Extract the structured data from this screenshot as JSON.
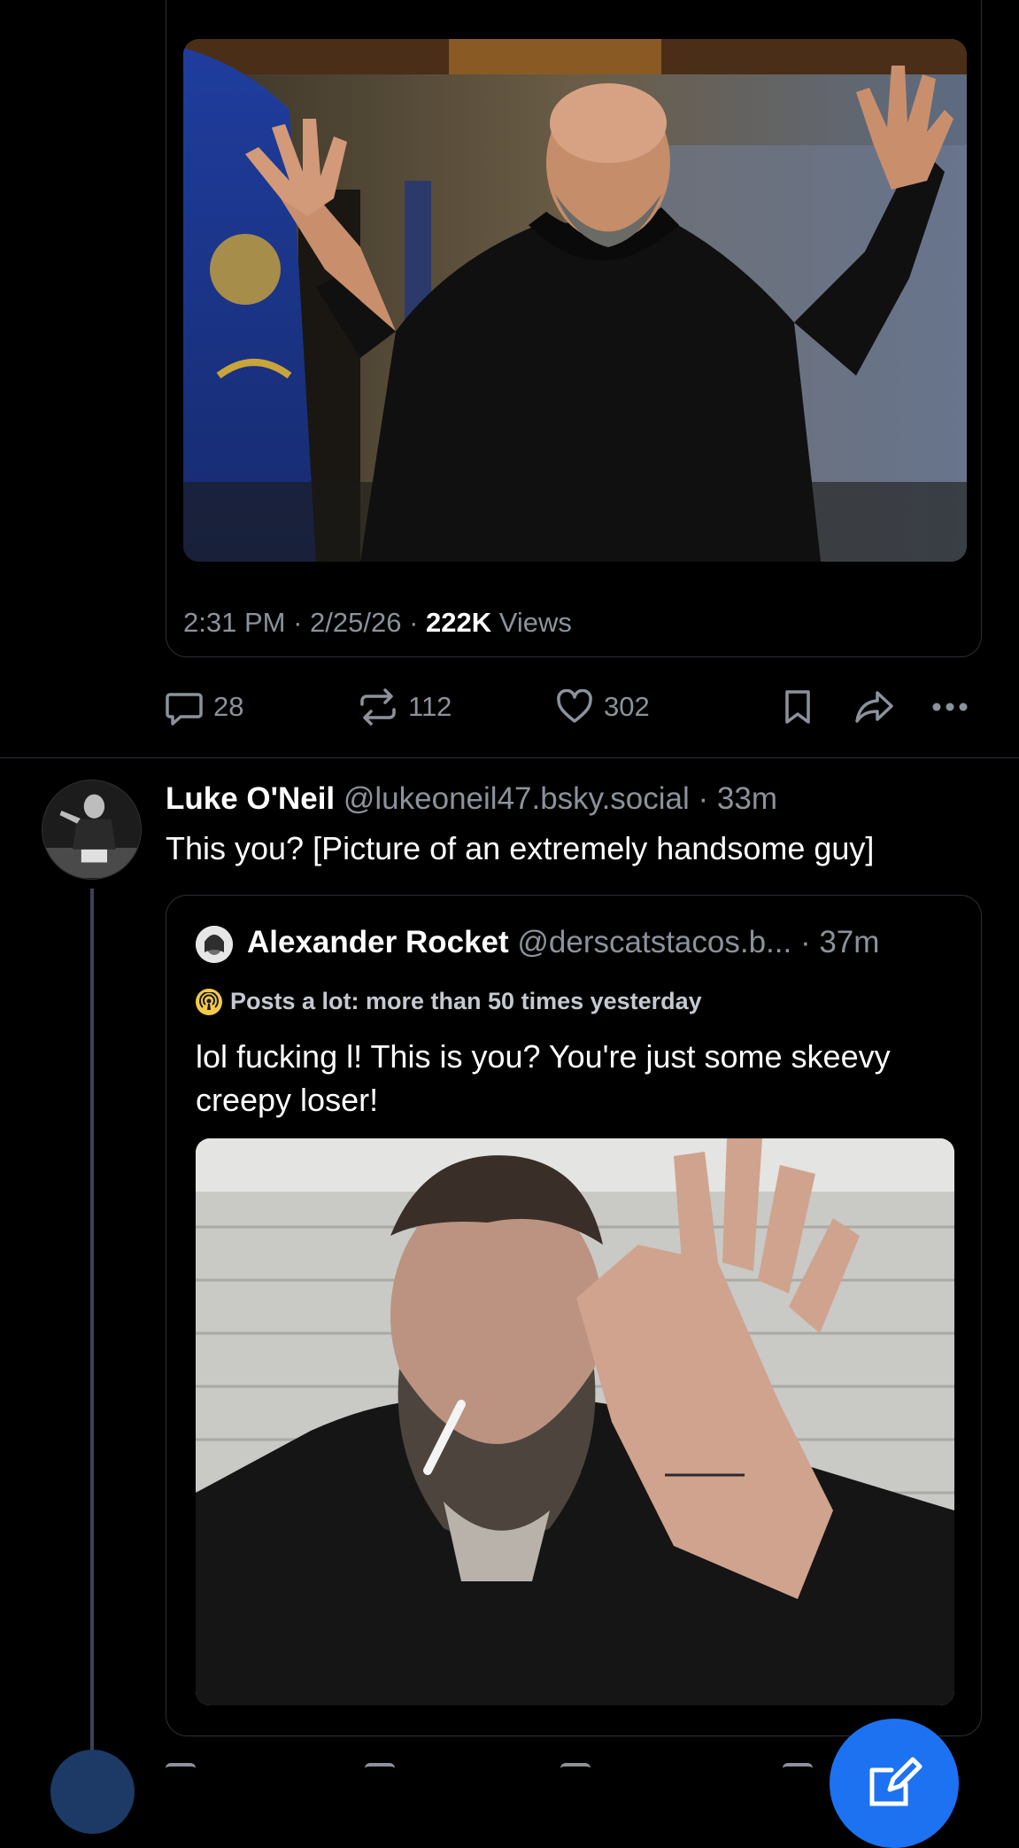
{
  "first_post": {
    "meta": {
      "time": "2:31 PM",
      "sep": " · ",
      "date": "2/25/26",
      "views_count": "222K",
      "views_label": " Views"
    },
    "actions": {
      "reply_count": "28",
      "repost_count": "112",
      "like_count": "302"
    }
  },
  "reply_post": {
    "author_name": "Luke O'Neil",
    "author_handle": " @lukeoneil47.bsky.social · 33m",
    "text": "This you? [Picture of an extremely handsome guy]",
    "quote": {
      "author_name": "Alexander Rocket",
      "author_handle": " @derscatstacos.b... · 37m",
      "badge": "Posts a lot: more than 50 times yesterday",
      "text": "lol fucking l! This is you? You're just some skeevy creepy  loser!"
    }
  },
  "colors": {
    "background": "#000000",
    "muted": "#8b929c",
    "border": "#2b2f36",
    "accent": "#1d72f2",
    "badge": "#f2c94c"
  },
  "icons": [
    "reply-icon",
    "repost-icon",
    "like-icon",
    "bookmark-icon",
    "share-icon",
    "more-icon",
    "compose-icon",
    "broadcast-icon"
  ]
}
